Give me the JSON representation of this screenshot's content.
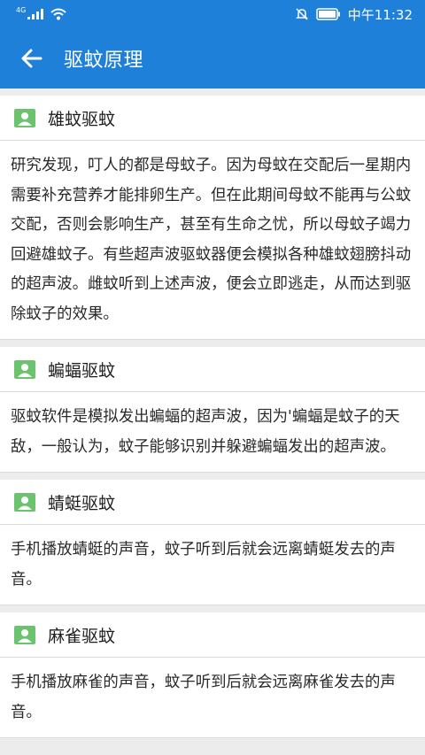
{
  "status_bar": {
    "network_label": "4G",
    "time": "中午11:32",
    "icons": [
      "signal-icon",
      "wifi-icon",
      "mute-icon",
      "battery-icon"
    ]
  },
  "header": {
    "back_icon": "arrow-left-icon",
    "title": "驱蚊原理"
  },
  "cards": [
    {
      "icon": "person-card-icon",
      "title": "雄蚊驱蚊",
      "body": "研究发现，叮人的都是母蚊子。因为母蚊在交配后一星期内需要补充营养才能排卵生产。但在此期间母蚊不能再与公蚊交配，否则会影响生产，甚至有生命之忧，所以母蚊子竭力回避雄蚊子。有些超声波驱蚊器便会模拟各种雄蚊翅膀抖动的超声波。雌蚊听到上述声波，便会立即逃走，从而达到驱除蚊子的效果。"
    },
    {
      "icon": "person-card-icon",
      "title": "蝙蝠驱蚊",
      "body": "驱蚊软件是模拟发出蝙蝠的超声波，因为'蝙蝠是蚊子的天敌，一般认为，蚊子能够识别并躲避蝙蝠发出的超声波。"
    },
    {
      "icon": "person-card-icon",
      "title": "蜻蜓驱蚊",
      "body": "手机播放蜻蜓的声音，蚊子听到后就会远离蜻蜓发去的声音。"
    },
    {
      "icon": "person-card-icon",
      "title": "麻雀驱蚊",
      "body": "手机播放麻雀的声音，蚊子听到后就会远离麻雀发去的声音。"
    }
  ],
  "colors": {
    "primary": "#1e80d9",
    "icon_green": "#6cc36e",
    "background": "#ececec"
  }
}
